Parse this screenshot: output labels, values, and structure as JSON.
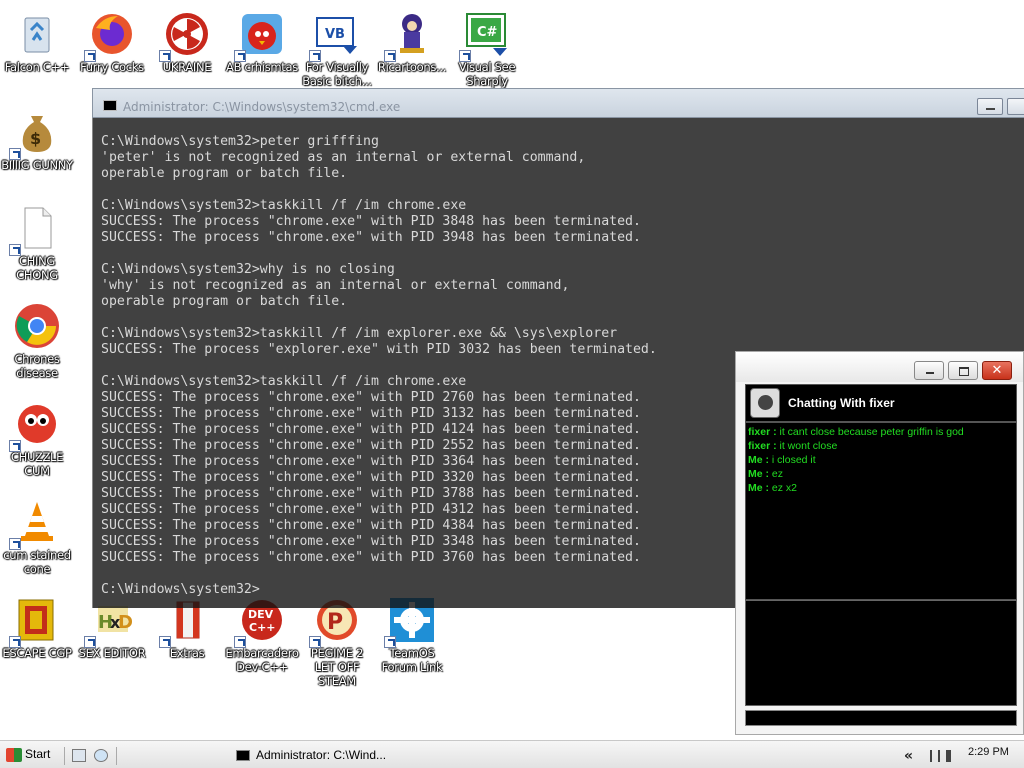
{
  "desktop": {
    "icons": [
      {
        "label": "Falcon C++"
      },
      {
        "label": "Furry Cocks"
      },
      {
        "label": "UKRAINE"
      },
      {
        "label": "AB crhismtas"
      },
      {
        "label": "For Visually Basic bitch..."
      },
      {
        "label": "Ricartoons..."
      },
      {
        "label": "Visual See Sharply Eye..."
      },
      {
        "label": "BIllIG GUNNY"
      },
      {
        "label": "CHING CHONG"
      },
      {
        "label": "Chrones disease"
      },
      {
        "label": "CHUZZLE CUM"
      },
      {
        "label": "cum stained cone"
      },
      {
        "label": "ESCAPE CGP"
      },
      {
        "label": "SEX EDITOR"
      },
      {
        "label": "Extras"
      },
      {
        "label": "Embarcadero Dev-C++"
      },
      {
        "label": "PEGIME 2 LET OFF STEAM"
      },
      {
        "label": "TeamOS Forum Link"
      }
    ]
  },
  "cmd": {
    "title": "Administrator: C:\\Windows\\system32\\cmd.exe",
    "lines": [
      "C:\\Windows\\system32>peter grifffing",
      "'peter' is not recognized as an internal or external command,",
      "operable program or batch file.",
      "",
      "C:\\Windows\\system32>taskkill /f /im chrome.exe",
      "SUCCESS: The process \"chrome.exe\" with PID 3848 has been terminated.",
      "SUCCESS: The process \"chrome.exe\" with PID 3948 has been terminated.",
      "",
      "C:\\Windows\\system32>why is no closing",
      "'why' is not recognized as an internal or external command,",
      "operable program or batch file.",
      "",
      "C:\\Windows\\system32>taskkill /f /im explorer.exe && \\sys\\explorer",
      "SUCCESS: The process \"explorer.exe\" with PID 3032 has been terminated.",
      "",
      "C:\\Windows\\system32>taskkill /f /im chrome.exe",
      "SUCCESS: The process \"chrome.exe\" with PID 2760 has been terminated.",
      "SUCCESS: The process \"chrome.exe\" with PID 3132 has been terminated.",
      "SUCCESS: The process \"chrome.exe\" with PID 4124 has been terminated.",
      "SUCCESS: The process \"chrome.exe\" with PID 2552 has been terminated.",
      "SUCCESS: The process \"chrome.exe\" with PID 3364 has been terminated.",
      "SUCCESS: The process \"chrome.exe\" with PID 3320 has been terminated.",
      "SUCCESS: The process \"chrome.exe\" with PID 3788 has been terminated.",
      "SUCCESS: The process \"chrome.exe\" with PID 4312 has been terminated.",
      "SUCCESS: The process \"chrome.exe\" with PID 4384 has been terminated.",
      "SUCCESS: The process \"chrome.exe\" with PID 3348 has been terminated.",
      "SUCCESS: The process \"chrome.exe\" with PID 3760 has been terminated.",
      "",
      "C:\\Windows\\system32>"
    ]
  },
  "chat": {
    "title": "Chatting With fixer",
    "close_glyph": "✕",
    "messages": [
      {
        "who": "fixer :",
        "text": " it cant close because peter griffin is god"
      },
      {
        "who": "fixer :",
        "text": " it wont close"
      },
      {
        "who": "Me :",
        "text": " i closed it"
      },
      {
        "who": "Me :",
        "text": " ez"
      },
      {
        "who": "Me :",
        "text": " ez x2"
      }
    ]
  },
  "taskbar": {
    "start_label": "Start",
    "task_label": "Administrator: C:\\Wind...",
    "chevron": "«",
    "clock": "2:29 PM"
  }
}
